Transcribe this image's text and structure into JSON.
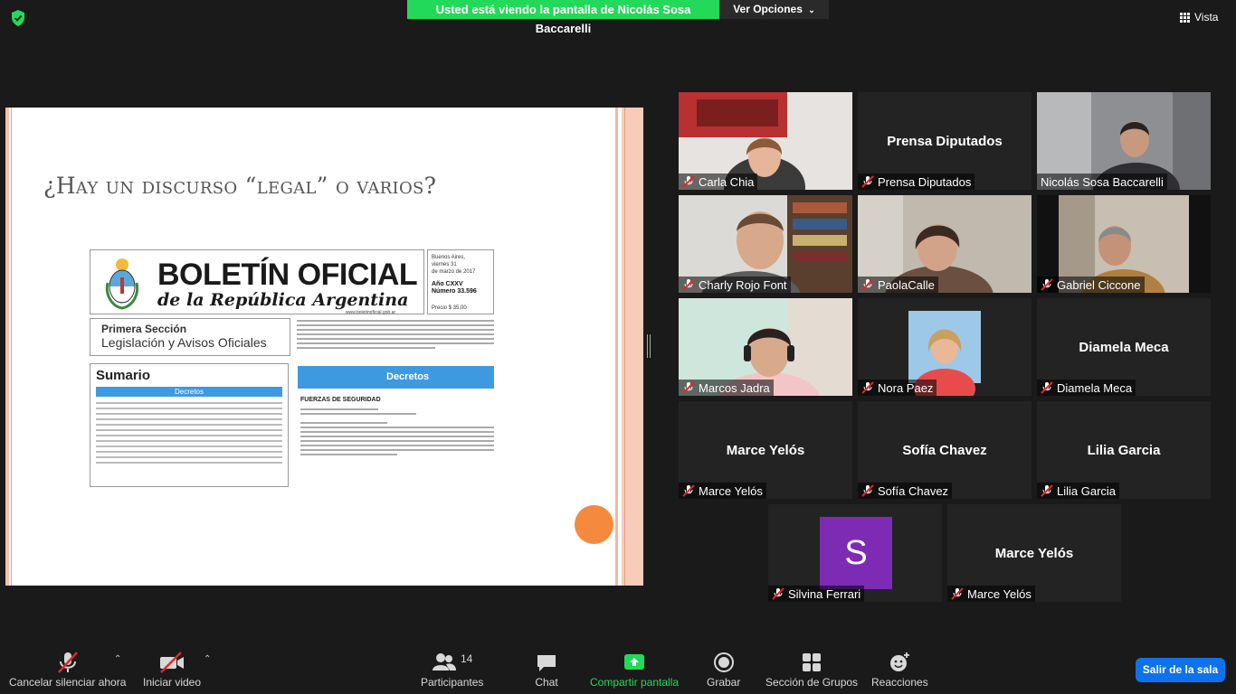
{
  "top_bar": {
    "share_banner": "Usted está viendo la pantalla de Nicolás Sosa Baccarelli",
    "view_options": "Ver Opciones",
    "view_button": "Vista"
  },
  "slide": {
    "title": "¿Hay un discurso “legal” o varios?",
    "document": {
      "title": "BOLETÍN OFICIAL",
      "subtitle": "de la República Argentina",
      "url": "www.boletinoficial.gob.ar",
      "date_lines": [
        "Buenos Aires,",
        "viernes 31",
        "de marzo de 2017"
      ],
      "year": "Año CXXV",
      "number": "Número 33.596",
      "price": "Precio $ 35,00",
      "section_title": "Primera Sección",
      "section_subtitle": "Legislación y Avisos Oficiales",
      "summary_title": "Sumario",
      "summary_bar": "Decretos",
      "decretos_label": "Decretos",
      "fuerzas_label": "FUERZAS DE SEGURIDAD"
    }
  },
  "participants": [
    {
      "name": "Carla Chia",
      "muted": true,
      "video": true
    },
    {
      "name": "Prensa Diputados",
      "muted": true,
      "video": false
    },
    {
      "name": "Nicolás Sosa Baccarelli",
      "muted": false,
      "video": true,
      "active": true
    },
    {
      "name": "Charly Rojo Font",
      "muted": true,
      "video": true
    },
    {
      "name": "PaolaCalle",
      "muted": true,
      "video": true
    },
    {
      "name": "Gabriel Ciccone",
      "muted": true,
      "video": true
    },
    {
      "name": "Marcos Jadra",
      "muted": true,
      "video": true
    },
    {
      "name": "Nora Paez",
      "muted": true,
      "video": true
    },
    {
      "name": "Diamela Meca",
      "muted": true,
      "video": false
    },
    {
      "name": "Marce Yelós",
      "muted": true,
      "video": false
    },
    {
      "name": "Sofía Chavez",
      "muted": true,
      "video": false
    },
    {
      "name": "Lilia Garcia",
      "muted": true,
      "video": false
    },
    {
      "name": "Silvina Ferrari",
      "muted": true,
      "video": false,
      "avatar_letter": "S",
      "avatar_color": "#7d2bb4"
    },
    {
      "name": "Marce Yelós",
      "muted": true,
      "video": false
    }
  ],
  "toolbar": {
    "mute": "Cancelar silenciar ahora",
    "video": "Iniciar video",
    "participants": "Participantes",
    "participants_count": "14",
    "chat": "Chat",
    "share": "Compartir pantalla",
    "record": "Grabar",
    "breakout": "Sección de Grupos",
    "reactions": "Reacciones",
    "leave": "Salir de la sala"
  },
  "colors": {
    "share_banner": "#23d959",
    "active_speaker": "#c5e33b",
    "leave_button": "#0e72ed",
    "share_icon": "#23d959",
    "slide_dot": "#f58a3e"
  }
}
